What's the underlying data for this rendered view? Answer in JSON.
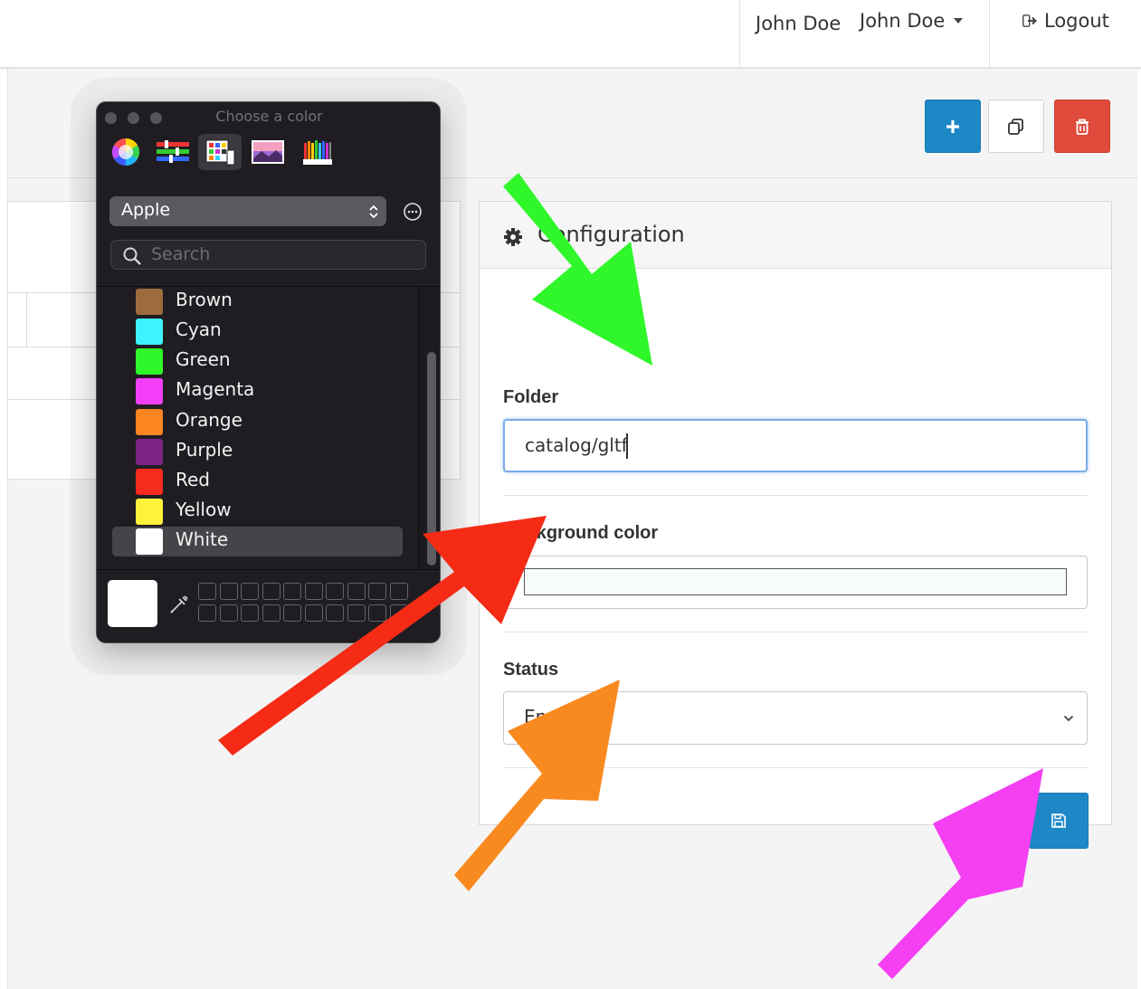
{
  "header": {
    "user_name": "John Doe",
    "user_menu_label": "John Doe",
    "logout_label": "Logout"
  },
  "actions": {
    "add_icon": "plus-icon",
    "copy_icon": "copy-icon",
    "delete_icon": "trash-icon"
  },
  "config": {
    "title": "Configuration",
    "folder_label": "Folder",
    "folder_value": "catalog/gltf",
    "background_color_label": "Background color",
    "background_color_value": "#f7fcfd",
    "status_label": "Status",
    "status_value": "Enabled",
    "save_icon": "save-icon"
  },
  "color_picker": {
    "title": "Choose a color",
    "palette": "Apple",
    "search_placeholder": "Search",
    "colors": [
      {
        "name": "Brown",
        "hex": "#9c6c3c"
      },
      {
        "name": "Cyan",
        "hex": "#3ff2ff"
      },
      {
        "name": "Green",
        "hex": "#2ff82a"
      },
      {
        "name": "Magenta",
        "hex": "#f23ff7"
      },
      {
        "name": "Orange",
        "hex": "#fb8520"
      },
      {
        "name": "Purple",
        "hex": "#7d2384"
      },
      {
        "name": "Red",
        "hex": "#f62a1d"
      },
      {
        "name": "Yellow",
        "hex": "#fff23a"
      },
      {
        "name": "White",
        "hex": "#ffffff"
      }
    ],
    "selected_color": "White",
    "current_color": "#ffffff"
  },
  "annotations": {
    "arrow_colors": [
      "#2ff72a",
      "#f52b16",
      "#f98a1f",
      "#f53ff2"
    ]
  },
  "colors": {
    "primary": "#1e88c7",
    "danger": "#e04a3b",
    "picker_bg": "#1f1d22"
  }
}
